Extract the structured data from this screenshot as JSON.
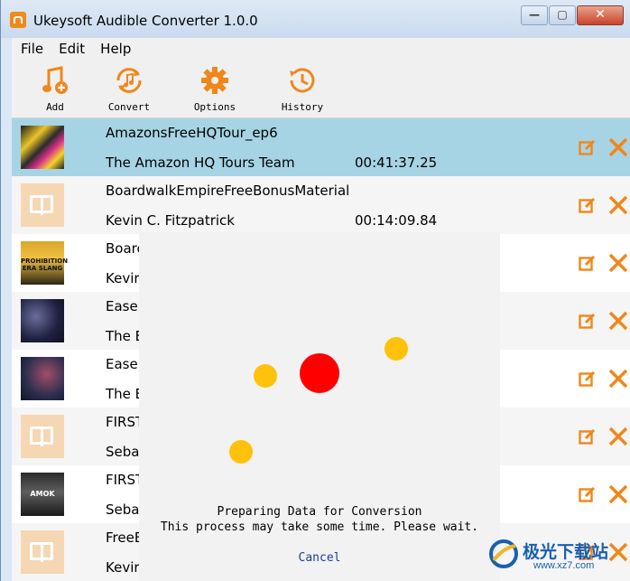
{
  "window": {
    "title": "Ukeysoft Audible Converter 1.0.0"
  },
  "menu": [
    "File",
    "Edit",
    "Help"
  ],
  "toolbar": [
    {
      "label": "Add",
      "icon": "add-music-icon"
    },
    {
      "label": "Convert",
      "icon": "convert-icon"
    },
    {
      "label": "Options",
      "icon": "gear-icon"
    },
    {
      "label": "History",
      "icon": "history-icon"
    }
  ],
  "rows": [
    {
      "title": "AmazonsFreeHQTour_ep6",
      "author": "The Amazon HQ Tours Team",
      "duration": "00:41:37.25",
      "thumb": "cover-art"
    },
    {
      "title": "BoardwalkEmpireFreeBonusMaterial",
      "author": "Kevin C. Fitzpatrick",
      "duration": "00:14:09.84",
      "thumb": "book-icon"
    },
    {
      "title": "Boarc",
      "author": "Kevir",
      "duration": "",
      "thumb": "cover-art",
      "thumb_text": "PROHIBITION ERA SLANG"
    },
    {
      "title": "Easei",
      "author": "The E",
      "duration": "",
      "thumb": "cover-art"
    },
    {
      "title": "Easei",
      "author": "The E",
      "duration": "",
      "thumb": "cover-art"
    },
    {
      "title": "FIRST",
      "author": "Seba",
      "duration": "",
      "thumb": "book-icon"
    },
    {
      "title": "FIRST",
      "author": "Seba",
      "duration": "",
      "thumb": "cover-art",
      "thumb_text": "AMOK"
    },
    {
      "title": "FreeE",
      "author": "Kevir",
      "duration": "",
      "thumb": "book-icon"
    }
  ],
  "progress_dialog": {
    "message_line1": "Preparing Data for Conversion",
    "message_line2": "This process may take some time.  Please wait.",
    "cancel_label": "Cancel"
  },
  "watermark": {
    "text_cn": "极光下载站",
    "url": "www.xz7.com"
  },
  "colors": {
    "accent_orange": "#f0871a",
    "selected_row": "#a7d4e4",
    "spinner_red": "#ff0000",
    "spinner_yellow": "#ffc20a"
  }
}
